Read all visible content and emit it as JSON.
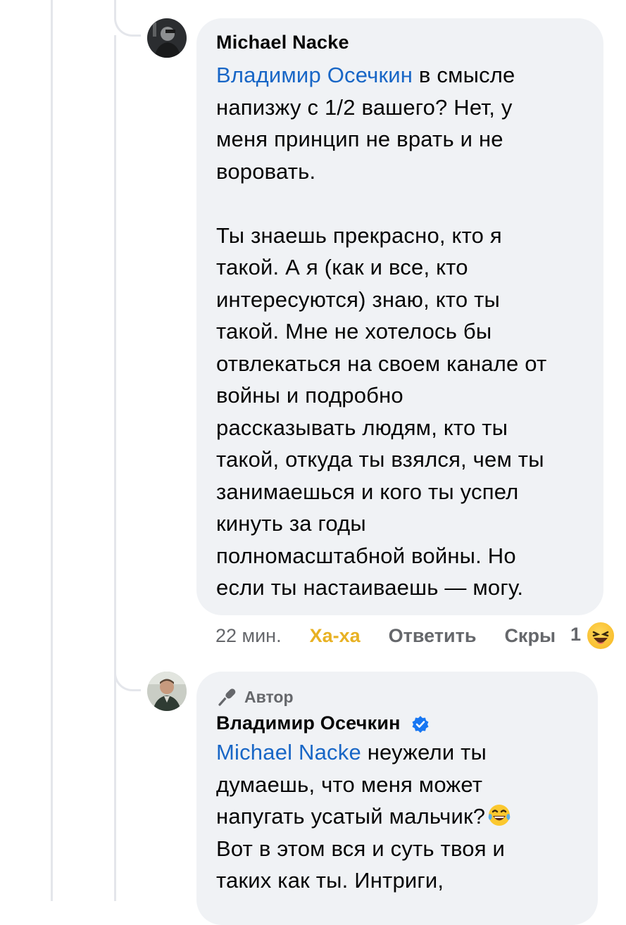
{
  "comments": [
    {
      "author": "Michael Nacke",
      "mention": "Владимир Осечкин",
      "text": " в смысле\nнапизжу с 1/2 вашего? Нет, у\nменя принцип не врать и не\nворовать.\n\nТы знаешь прекрасно, кто я\nтакой. А я (как и все, кто\nинтересуются) знаю, кто ты\nтакой. Мне не хотелось бы\nотвлекаться на своем канале от\nвойны и подробно\nрассказывать людям, кто ты\nтакой, откуда ты взялся, чем ты\nзанимаешься и кого ты успел\nкинуть за годы\nполномасштабной войны. Но\nесли ты настаиваешь — могу.",
      "time": "22 мин.",
      "reaction_label": "Ха-ха",
      "reply_label": "Ответить",
      "hide_label": "Скры",
      "reaction_count": "1",
      "reaction_icon": "laughing-emoji-icon"
    },
    {
      "badge": "Автор",
      "author": "Владимир Осечкин",
      "verified": true,
      "mention": "Michael Nacke",
      "text": " неужели ты\nдумаешь, что меня может\nнапугать усатый мальчик?",
      "text2": "Вот в этом вся и суть твоя и\nтаких как ты. Интриги,",
      "inline_emoji": "tears-of-joy-emoji-icon"
    }
  ],
  "colors": {
    "mention": "#1866c6",
    "bubble": "#f0f2f5",
    "reaction_haha": "#e8b123",
    "secondary_text": "#65676b",
    "verified": "#1877f2"
  }
}
